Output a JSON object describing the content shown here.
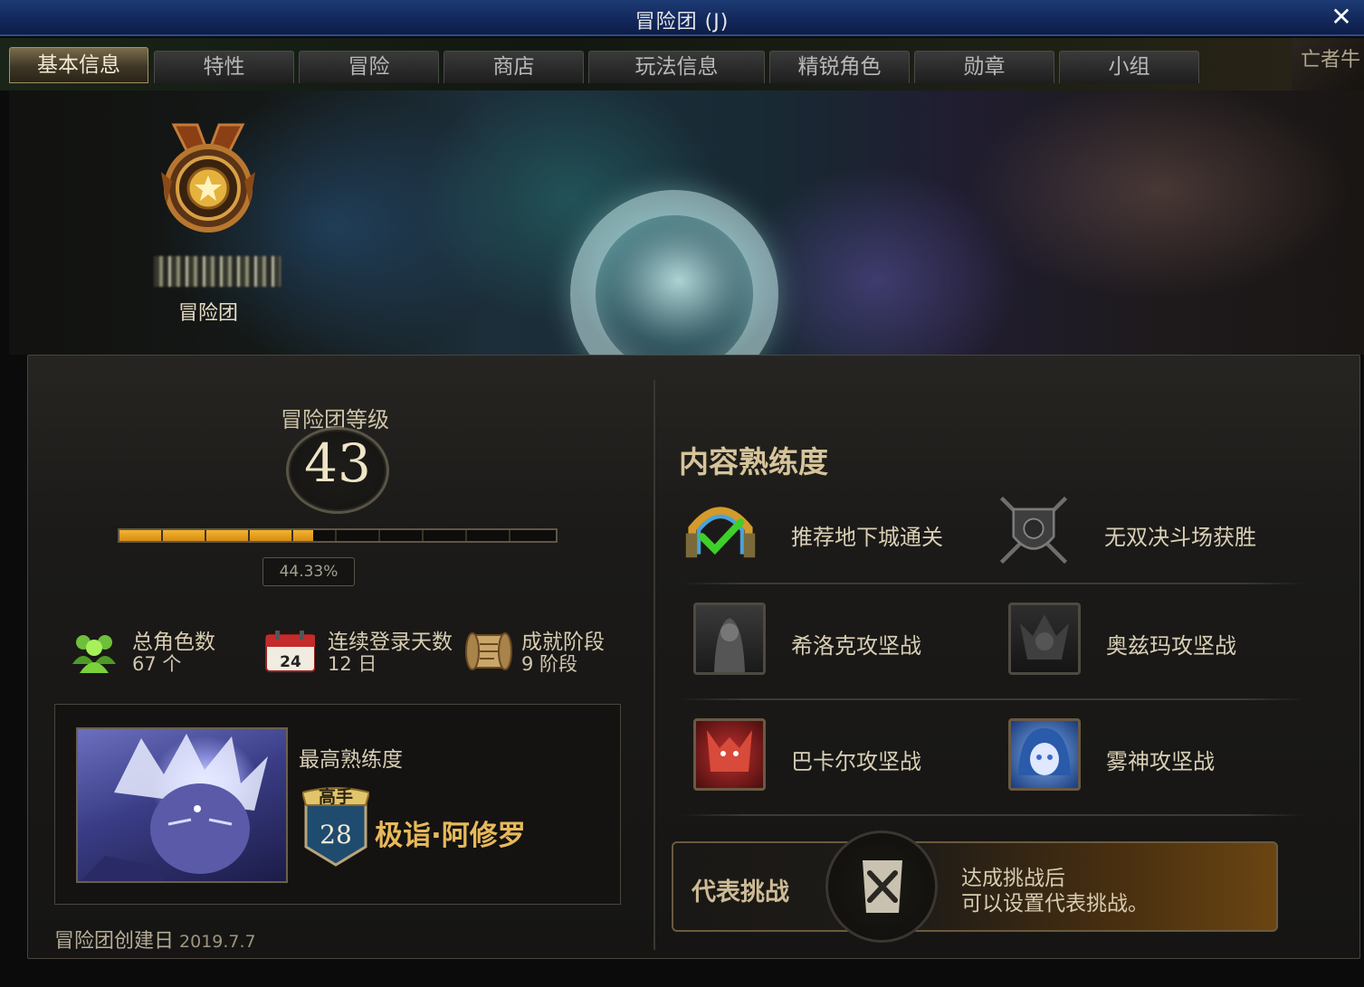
{
  "window": {
    "title": "冒险团 (J)",
    "close_icon": "close-icon"
  },
  "tabs": [
    {
      "label": "基本信息",
      "active": true
    },
    {
      "label": "特性"
    },
    {
      "label": "冒险"
    },
    {
      "label": "商店"
    },
    {
      "label": "玩法信息"
    },
    {
      "label": "精锐角色"
    },
    {
      "label": "勋章"
    },
    {
      "label": "小组"
    }
  ],
  "tab_corner_text": "亡者牛",
  "banner": {
    "guild_label": "冒险团",
    "crest_icon": "bronze-medal-icon"
  },
  "level": {
    "title": "冒险团等级",
    "value": "43",
    "progress_percent": 44.33,
    "progress_text": "44.33%"
  },
  "stats": [
    {
      "icon": "characters-icon",
      "label": "总角色数",
      "value": "67 个"
    },
    {
      "icon": "calendar-icon",
      "calendar_day": "24",
      "label": "连续登录天数",
      "value": "12 日"
    },
    {
      "icon": "scroll-icon",
      "label": "成就阶段",
      "value": "9 阶段"
    }
  ],
  "max_mastery": {
    "title": "最高熟练度",
    "rank_label": "高手",
    "rank_value": "28",
    "character_name": "极诣·阿修罗"
  },
  "created": {
    "label": "冒险团创建日",
    "date": "2019.7.7"
  },
  "mastery": {
    "title": "内容熟练度",
    "items": [
      {
        "icon": "dungeon-clear-icon",
        "label": "推荐地下城通关",
        "completed": true
      },
      {
        "icon": "arena-shield-icon",
        "label": "无双决斗场获胜",
        "completed": false
      },
      {
        "icon": "boss-hilder-icon",
        "label": "希洛克攻坚战",
        "completed": false
      },
      {
        "icon": "boss-ozma-icon",
        "label": "奥兹玛攻坚战",
        "completed": false
      },
      {
        "icon": "boss-bakal-icon",
        "label": "巴卡尔攻坚战",
        "completed": true
      },
      {
        "icon": "boss-mist-icon",
        "label": "雾神攻坚战",
        "completed": true
      }
    ]
  },
  "challenge": {
    "label": "代表挑战",
    "text_line1": "达成挑战后",
    "text_line2": "可以设置代表挑战。"
  },
  "colors": {
    "accent_gold": "#e8b95a",
    "xp_fill": "#f3b431",
    "title_bar": "#12275a"
  }
}
